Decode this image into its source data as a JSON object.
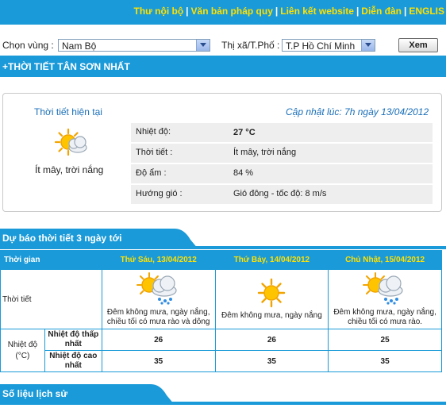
{
  "top_links": {
    "internal": "Thư nội bộ",
    "legal": "Văn bản pháp quy",
    "website_links": "Liên kết website",
    "forum": "Diễn đàn",
    "english": "ENGLIS"
  },
  "filter": {
    "region_label": "Chọn vùng :",
    "region_value": "Nam Bộ",
    "city_label": "Thị xã/T.Phố :",
    "city_value": "T.P Hồ Chí Minh",
    "view_button": "Xem"
  },
  "station_title": "+THỜI TIẾT  TÂN SƠN NHẤT",
  "current": {
    "title": "Thời tiết hiện tại",
    "updated": "Cập nhật lúc: 7h ngày 13/04/2012",
    "icon": "partly-cloudy-sun-icon",
    "summary": "Ít mây, trời nắng",
    "rows": [
      {
        "label": "Nhiệt độ:",
        "value": "27 °C"
      },
      {
        "label": "Thời tiết :",
        "value": "Ít mây, trời nắng"
      },
      {
        "label": "Độ ẩm :",
        "value": "84 %"
      },
      {
        "label": "Hướng gió :",
        "value": "Gió đông - tốc độ: 8 m/s"
      }
    ]
  },
  "forecast": {
    "section_title": "Dự báo thời tiết 3 ngày tới",
    "time_header": "Thời gian",
    "weather_label": "Thời tiết",
    "temp_label": "Nhiệt độ",
    "temp_unit": "(°C)",
    "min_label": "Nhiệt độ thấp nhất",
    "max_label": "Nhiệt độ cao nhất",
    "days": [
      {
        "date": "Thứ Sáu, 13/04/2012",
        "icon": "sun-cloud-rain-icon",
        "desc": "Đêm không mưa, ngày nắng, chiều tối có mưa rào và dông",
        "min": "26",
        "max": "35"
      },
      {
        "date": "Thứ Bảy, 14/04/2012",
        "icon": "sun-icon",
        "desc": "Đêm không mưa, ngày nắng",
        "min": "26",
        "max": "35"
      },
      {
        "date": "Chủ Nhật, 15/04/2012",
        "icon": "sun-cloud-rain-icon",
        "desc": "Đêm không mưa, ngày nắng, chiều tối có mưa rào.",
        "min": "25",
        "max": "35"
      }
    ]
  },
  "history": {
    "section_title": "Số liệu lịch sử"
  },
  "colors": {
    "bar_blue": "#1a9ad8",
    "link_yellow": "#ffe100",
    "title_blue": "#1a6fb8"
  }
}
